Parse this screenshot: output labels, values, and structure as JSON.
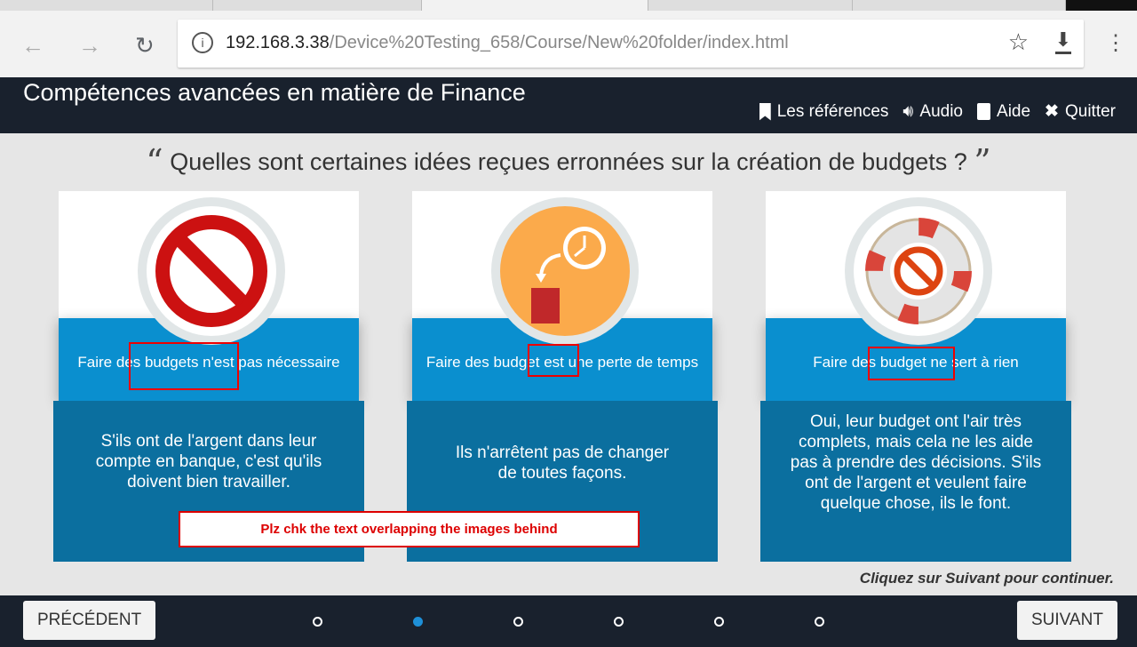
{
  "browser": {
    "url_host": "192.168.3.38",
    "url_path": "/Device%20Testing_658/Course/New%20folder/index.html"
  },
  "header": {
    "title": "Compétences avancées en matière de Finance",
    "nav": [
      {
        "label": "Les références",
        "icon": "bookmark-icon"
      },
      {
        "label": "Audio",
        "icon": "speaker-icon"
      },
      {
        "label": "Aide",
        "icon": "book-icon"
      },
      {
        "label": "Quitter",
        "icon": "close-icon"
      }
    ]
  },
  "question": "Quelles sont certaines idées reçues erronnées sur la création de budgets ?",
  "cards": [
    {
      "label": "Faire des budgets n'est pas nécessaire",
      "text": "S'ils ont de l'argent dans leur compte en banque, c'est qu'ils doivent bien travailler.",
      "icon": "prohibited-sign-icon"
    },
    {
      "label": "Faire des budget est une perte de temps",
      "text": "Ils n'arrêtent pas de changer de toutes façons.",
      "icon": "clock-trash-icon"
    },
    {
      "label": "Faire des budget ne sert à rien",
      "text": "Oui, leur budget ont l'air très complets, mais cela ne les aide pas à prendre des décisions. S'ils ont de l'argent et veulent faire quelque chose, ils le font.",
      "icon": "lifebuoy-prohibited-icon"
    }
  ],
  "annotation": "Plz chk the text overlapping the images behind",
  "continue_hint": "Cliquez sur Suivant pour continuer.",
  "footer": {
    "prev": "PRÉCÉDENT",
    "next": "SUIVANT",
    "pages": 6,
    "current_page": 2
  },
  "colors": {
    "header": "#19212d",
    "card_blue": "#0a8fcf",
    "card_dark": "#0b6f9f"
  }
}
